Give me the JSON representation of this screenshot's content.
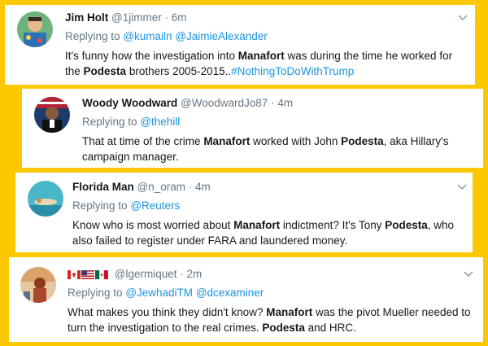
{
  "tweets": [
    {
      "name": "Jim Holt",
      "handle": "@1jimmer",
      "separator": "·",
      "time": "6m",
      "replying_prefix": "Replying to",
      "reply_to": [
        "@kumailn",
        "@JaimieAlexander"
      ],
      "text": {
        "t1": "It's funny how the investigation into ",
        "b1": "Manafort",
        "t2": " was during the time he worked for the ",
        "b2": "Podesta",
        "t3": " brothers 2005-2015..",
        "hashtag": "#NothingToDoWithTrump"
      }
    },
    {
      "name": "Woody Woodward",
      "handle": "@WoodwardJo87",
      "separator": "·",
      "time": "4m",
      "replying_prefix": "Replying to",
      "reply_to": [
        "@thehill"
      ],
      "text": {
        "t1": "That at time of the crime ",
        "b1": "Manafort",
        "t2": " worked with John ",
        "b2": "Podesta",
        "t3": ", aka Hillary's campaign manager."
      }
    },
    {
      "name": "Florida Man",
      "handle": "@n_oram",
      "separator": "·",
      "time": "4m",
      "replying_prefix": "Replying to",
      "reply_to": [
        "@Reuters"
      ],
      "text": {
        "t1": "Know who is most worried about ",
        "b1": "Manafort",
        "t2": " indictment? It's Tony ",
        "b2": "Podesta",
        "t3": ", who also failed to register under FARA and laundered money."
      }
    },
    {
      "name": "",
      "handle": "@lgermiquet",
      "separator": "·",
      "time": "2m",
      "replying_prefix": "Replying to",
      "reply_to": [
        "@JewhadiTM",
        "@dcexaminer"
      ],
      "text": {
        "t1": "What makes you think they didn't know? ",
        "b1": "Manafort",
        "t2": " was the pivot Mueller needed to turn the investigation to the real crimes.  ",
        "b2": "Podesta",
        "t3": " and HRC."
      }
    }
  ],
  "colors": {
    "background": "#fdc800",
    "link": "#1b95e0",
    "meta": "#657786",
    "text": "#14171a"
  }
}
